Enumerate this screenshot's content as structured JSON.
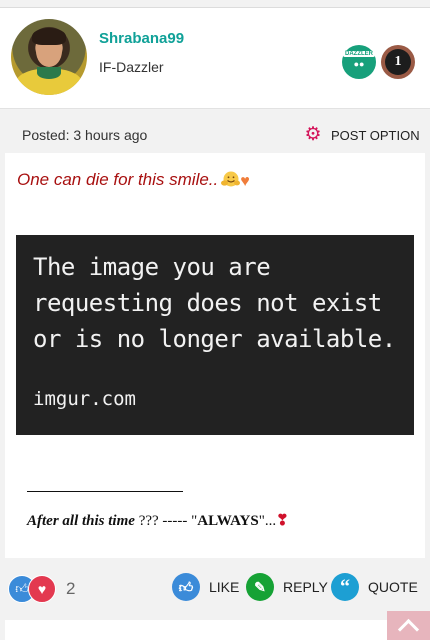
{
  "user": {
    "username": "Shrabana99",
    "rank": "IF-Dazzler",
    "badges": [
      {
        "name": "dazzler-badge",
        "label": "DAZZLER",
        "color": "#17a07b"
      },
      {
        "name": "rank-one-badge",
        "label": "1",
        "color": "#9a5a45"
      }
    ]
  },
  "post_meta": {
    "posted": "Posted: 3 hours ago",
    "option_label": "POST OPTION",
    "option_icon": "gear-icon",
    "accent": "#d4145a"
  },
  "post": {
    "headline": "One can die for this smile..",
    "image_message_line1": "The image you are",
    "image_message_line2": "requesting does not exist",
    "image_message_line3": "or is no longer available.",
    "image_domain": "imgur.com",
    "tagline_lead": "After all this time ",
    "tagline_q": "???",
    "tagline_dash": " ----- \"",
    "tagline_caps": "ALWAYS",
    "tagline_end": "\"...",
    "tagline_heart": "❣"
  },
  "actions": {
    "reaction_count": "2",
    "like_label": "LIKE",
    "reply_label": "REPLY",
    "quote_label": "QUOTE",
    "colors": {
      "like": "#3b8bd9",
      "reply": "#16a235",
      "quote": "#1d9fd3",
      "love": "#e33950"
    }
  }
}
